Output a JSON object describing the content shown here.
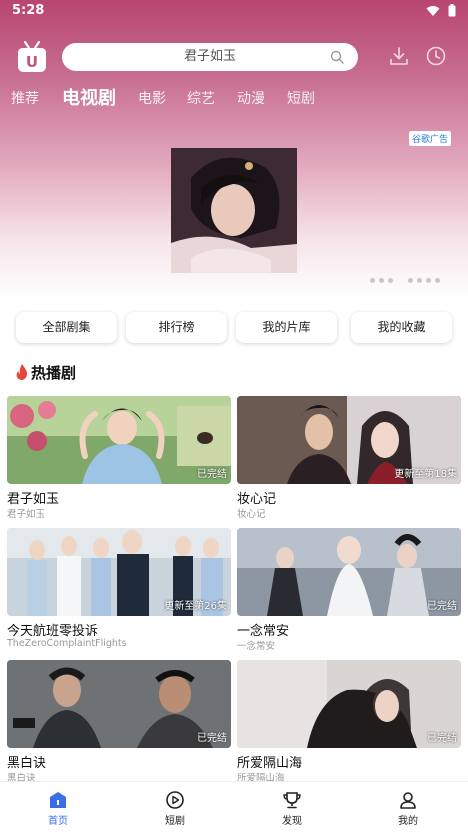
{
  "status_bar": {
    "time": "5:28"
  },
  "search": {
    "placeholder": "君子如玉"
  },
  "tabs": [
    {
      "label": "推荐"
    },
    {
      "label": "电视剧"
    },
    {
      "label": "电影"
    },
    {
      "label": "综艺"
    },
    {
      "label": "动漫"
    },
    {
      "label": "短剧"
    }
  ],
  "active_tab": "电视剧",
  "banner": {
    "ad_tag": "谷歌广告"
  },
  "quick_links": [
    {
      "label": "全部剧集"
    },
    {
      "label": "排行榜"
    },
    {
      "label": "我的片库"
    },
    {
      "label": "我的收藏"
    }
  ],
  "section": {
    "title": "热播剧"
  },
  "cards": [
    {
      "title": "君子如玉",
      "subtitle": "君子如玉",
      "status": "已完结"
    },
    {
      "title": "妆心记",
      "subtitle": "妆心记",
      "status": "更新至第18集"
    },
    {
      "title": "今天航班零投诉",
      "subtitle": "TheZeroComplaintFlights",
      "status": "更新至第26集"
    },
    {
      "title": "一念常安",
      "subtitle": "一念常安",
      "status": "已完结"
    },
    {
      "title": "黑白诀",
      "subtitle": "黑白诀",
      "status": "已完结"
    },
    {
      "title": "所爱隔山海",
      "subtitle": "所爱隔山海",
      "status": "已完结"
    }
  ],
  "bottom_nav": [
    {
      "label": "首页",
      "icon": "home-icon",
      "active": true
    },
    {
      "label": "短剧",
      "icon": "play-circle-icon",
      "active": false
    },
    {
      "label": "发现",
      "icon": "trophy-icon",
      "active": false
    },
    {
      "label": "我的",
      "icon": "profile-icon",
      "active": false
    }
  ],
  "colors": {
    "accent": "#3a6ee8",
    "header_top": "#b8456f",
    "ad_tag": "#2b7ed8"
  }
}
